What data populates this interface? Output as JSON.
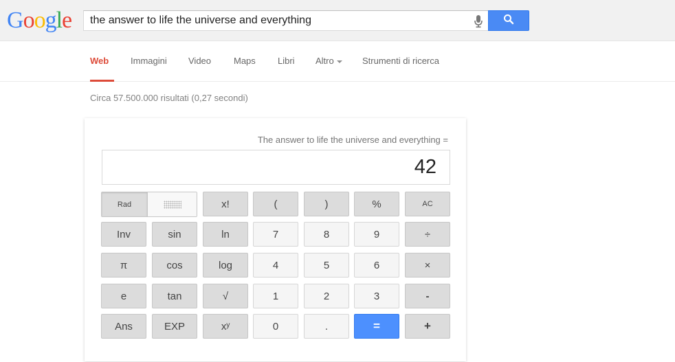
{
  "logo": {
    "letters": [
      "G",
      "o",
      "o",
      "g",
      "l",
      "e"
    ],
    "colors": [
      "#4285f4",
      "#ea4335",
      "#fbbc05",
      "#4285f4",
      "#34a853",
      "#ea4335"
    ]
  },
  "search": {
    "query": "the answer to life the universe and everything",
    "mic_icon": "microphone-icon",
    "button_icon": "magnifier-icon"
  },
  "nav": {
    "items": [
      "Web",
      "Immagini",
      "Video",
      "Maps",
      "Libri",
      "Altro",
      "Strumenti di ricerca"
    ],
    "active": "Web",
    "accent": "#dd4b39"
  },
  "result_stats": "Circa 57.500.000 risultati (0,27 secondi)",
  "calculator": {
    "expression": "The answer to life the universe and everything =",
    "result": "42",
    "rows": [
      [
        "Rad",
        "",
        "x!",
        "(",
        ")",
        "%",
        "AC"
      ],
      [
        "Inv",
        "sin",
        "ln",
        "7",
        "8",
        "9",
        "÷"
      ],
      [
        "π",
        "cos",
        "log",
        "4",
        "5",
        "6",
        "×"
      ],
      [
        "e",
        "tan",
        "√",
        "1",
        "2",
        "3",
        "-"
      ],
      [
        "Ans",
        "EXP",
        "xʸ",
        "0",
        ".",
        "=",
        "+"
      ]
    ],
    "equals_color": "#4d90fe"
  }
}
